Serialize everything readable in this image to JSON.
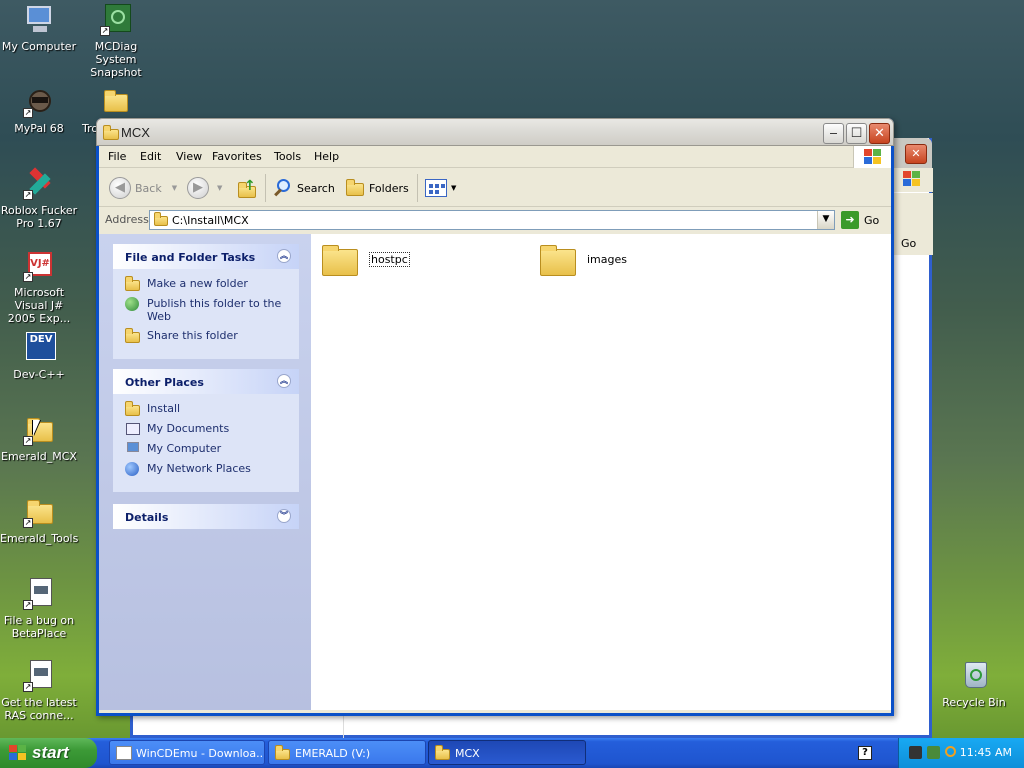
{
  "desktop": {
    "icons": [
      {
        "label": "My Computer",
        "icon": "computer-icon"
      },
      {
        "label": "MCDiag System Snapshot",
        "icon": "circuit-board-icon"
      },
      {
        "label": "MyPal 68",
        "icon": "raccoon-icon"
      },
      {
        "label": "Tro",
        "icon": "folder-icon"
      },
      {
        "label": "Roblox Fucker Pro 1.67",
        "icon": "tools-icon"
      },
      {
        "label": "Microsoft Visual J# 2005 Exp...",
        "icon": "vj-icon"
      },
      {
        "label": "Dev-C++",
        "icon": "devcpp-icon"
      },
      {
        "label": "Emerald_MCX",
        "icon": "folder-icon"
      },
      {
        "label": "Emerald_Tools",
        "icon": "folder-icon"
      },
      {
        "label": "File a bug on BetaPlace",
        "icon": "document-icon"
      },
      {
        "label": "Get the latest RAS conne...",
        "icon": "document-icon"
      },
      {
        "label": "Recycle Bin",
        "icon": "recycle-bin-icon"
      }
    ]
  },
  "back_window": {
    "go_label": "Go"
  },
  "window": {
    "title": "MCX",
    "menus": [
      "File",
      "Edit",
      "View",
      "Favorites",
      "Tools",
      "Help"
    ],
    "toolbar": {
      "back": "Back",
      "search": "Search",
      "folders": "Folders"
    },
    "address": {
      "label": "Address",
      "value": "C:\\Install\\MCX",
      "go": "Go"
    },
    "tasks_panel": {
      "title": "File and Folder Tasks",
      "items": [
        "Make a new folder",
        "Publish this folder to the Web",
        "Share this folder"
      ]
    },
    "places_panel": {
      "title": "Other Places",
      "items": [
        "Install",
        "My Documents",
        "My Computer",
        "My Network Places"
      ]
    },
    "details_panel": {
      "title": "Details"
    },
    "files": [
      {
        "name": "hostpc"
      },
      {
        "name": "images"
      }
    ]
  },
  "taskbar": {
    "start": "start",
    "tasks": [
      {
        "label": "WinCDEmu - Downloa..."
      },
      {
        "label": "EMERALD (V:)"
      },
      {
        "label": "MCX"
      }
    ],
    "clock": "11:45 AM"
  }
}
